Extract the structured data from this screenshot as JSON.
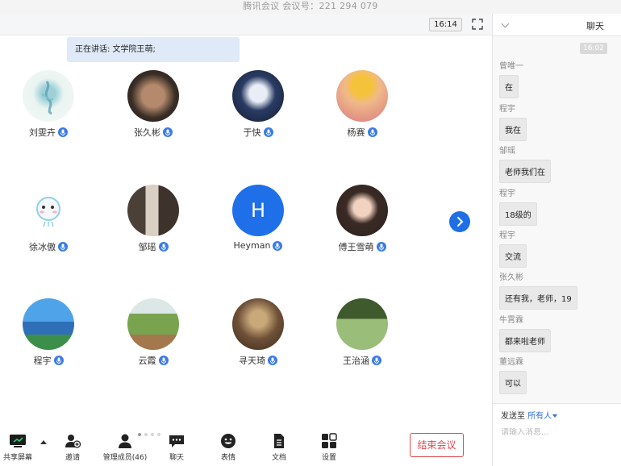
{
  "window": {
    "title": "腾讯会议 会议号：221 294 079"
  },
  "topbar": {
    "clock": "16:14"
  },
  "speaking": {
    "text": "正在讲话: 文学院王萌;"
  },
  "participants": [
    {
      "name": "刘雯卉",
      "avatar_color": "#e6f2ee"
    },
    {
      "name": "张久彬",
      "avatar_color": "#6b4f3c"
    },
    {
      "name": "于快",
      "avatar_color": "#1b2c4a"
    },
    {
      "name": "杨赛",
      "avatar_color": "#e7a26e"
    },
    {
      "name": "徐冰傲",
      "avatar_color": "#f3f8fb"
    },
    {
      "name": "邹瑶",
      "avatar_color": "#3a3027"
    },
    {
      "name": "Heyman",
      "avatar_color": "#1f70e8",
      "initial": "H"
    },
    {
      "name": "傅王雪萌",
      "avatar_color": "#40312b"
    },
    {
      "name": "程宇",
      "avatar_color": "#5aa9e6"
    },
    {
      "name": "云霞",
      "avatar_color": "#7aa45a"
    },
    {
      "name": "寻天琦",
      "avatar_color": "#7a5a3e"
    },
    {
      "name": "王治涵",
      "avatar_color": "#6f8a4e"
    }
  ],
  "toolbar": {
    "share": "共享屏幕",
    "invite": "邀请",
    "members": "管理成员(46)",
    "chat": "聊天",
    "emoji": "表情",
    "docs": "文档",
    "settings": "设置",
    "end": "结束会议"
  },
  "chat": {
    "title": "聊天",
    "time": "16:02",
    "messages": [
      {
        "sender": "曾唯一",
        "text": "在"
      },
      {
        "sender": "程宇",
        "text": "我在"
      },
      {
        "sender": "邹瑶",
        "text": "老师我们在"
      },
      {
        "sender": "程宇",
        "text": "18级的"
      },
      {
        "sender": "程宇",
        "text": "交流"
      },
      {
        "sender": "张久彬",
        "text": "还有我，老师，19"
      },
      {
        "sender": "牛霄霖",
        "text": "都来啦老师"
      },
      {
        "sender": "董远霖",
        "text": "可以"
      }
    ],
    "send_to_label": "发送至",
    "send_to_target": "所有人",
    "input_placeholder": "请输入消息..."
  },
  "colors": {
    "accent": "#1f70e8",
    "danger": "#e5484d"
  },
  "icons": {
    "share": "share-screen-icon",
    "invite": "invite-icon",
    "members": "members-icon",
    "chat": "chat-icon",
    "emoji": "emoji-icon",
    "docs": "document-icon",
    "settings": "settings-icon",
    "mic": "mic-icon",
    "next": "chevron-right-icon",
    "fullscreen": "fullscreen-icon"
  }
}
